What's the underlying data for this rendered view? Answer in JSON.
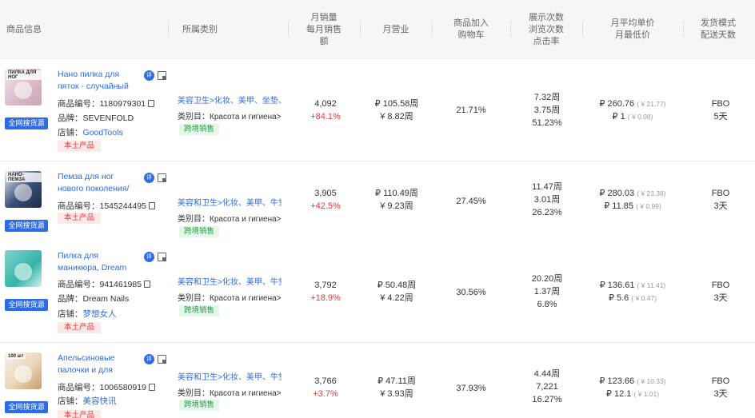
{
  "header": {
    "product_info": "商品信息",
    "category": "所属类别",
    "monthly_sales_1": "月销量",
    "monthly_sales_2": "每月销售",
    "monthly_sales_3": "额",
    "monthly_revenue": "月营业",
    "cart_1": "商品加入",
    "cart_2": "购物车",
    "views_1": "展示次数",
    "views_2": "浏览次数",
    "views_3": "点击率",
    "price_1": "月平均单价",
    "price_2": "月最低价",
    "ship_1": "发货模式",
    "ship_2": "配送天数"
  },
  "labels": {
    "search_badge": "全网搜货源",
    "eval_icon": "评",
    "sku_key": "商品编号：",
    "brand_key": "品牌：",
    "shop_key": "店铺：",
    "local_tag": "本土产品",
    "cat_key": "类别目：",
    "cross_tag": "跨境销售"
  },
  "rows": [
    {
      "thumb_text": "ПИЛКА ДЛЯ НОГ",
      "title": "Нано пилка для пяток - случайный цвет / Т...",
      "sku": "1180979301",
      "brand": "SEVENFOLD",
      "shop": "GoodTools",
      "category": "美容卫生>化妆、美甲、坐垫、",
      "sub_category": "Красота и гигиена>",
      "sales": "4,092",
      "sales_growth": "+84.1%",
      "revenue": "₽ 105.58周",
      "revenue_cny": "¥ 8.82周",
      "cart_rate": "21.71%",
      "views": "7.32周",
      "clicks": "3.75周",
      "ctr": "51.23%",
      "avg_price": "₽ 260.76",
      "avg_price_cny": "( ¥ 21.77)",
      "min_price": "₽ 1",
      "min_price_cny": "( ¥ 0.08)",
      "ship_mode": "FBO",
      "ship_days": "5天"
    },
    {
      "thumb_text": "НАНО-ПЕМЗА",
      "title": "Пемза для ног нового поколения/ Терка дл...",
      "sku": "1545244495",
      "brand": "",
      "shop": "",
      "category": "美容和卫生>化妆、美甲、牛堂、",
      "sub_category": "Красота и гигиена>",
      "sales": "3,905",
      "sales_growth": "+42.5%",
      "revenue": "₽ 110.49周",
      "revenue_cny": "¥ 9.23周",
      "cart_rate": "27.45%",
      "views": "11.47周",
      "clicks": "3.01周",
      "ctr": "26.23%",
      "avg_price": "₽ 280.03",
      "avg_price_cny": "( ¥ 23.38)",
      "min_price": "₽ 11.85",
      "min_price_cny": "( ¥ 0.99)",
      "ship_mode": "FBO",
      "ship_days": "3天"
    },
    {
      "thumb_text": "",
      "title": "Пилка для маникюра, Dream Nails набор пи...",
      "sku": "941461985",
      "brand": "Dream Nails",
      "shop": "梦想女人",
      "category": "美容和卫生>化妆、美甲、牛堂、",
      "sub_category": "Красота и гигиена>",
      "sales": "3,792",
      "sales_growth": "+18.9%",
      "revenue": "₽ 50.48周",
      "revenue_cny": "¥ 4.22周",
      "cart_rate": "30.56%",
      "views": "20.20周",
      "clicks": "1.37周",
      "ctr": "6.8%",
      "avg_price": "₽ 136.61",
      "avg_price_cny": "( ¥ 11.41)",
      "min_price": "₽ 5.6",
      "min_price_cny": "( ¥ 0.47)",
      "ship_mode": "FBO",
      "ship_days": "3天"
    },
    {
      "thumb_text": "100 шт",
      "title": "Апельсиновые палочки и для маникюра, пал...",
      "sku": "1006580919",
      "brand": "",
      "shop": "美容快讯",
      "category": "美容和卫生>化妆、美甲、牛堂、",
      "sub_category": "Красота и гигиена>",
      "sales": "3,766",
      "sales_growth": "+3.7%",
      "revenue": "₽ 47.11周",
      "revenue_cny": "¥ 3.93周",
      "cart_rate": "37.93%",
      "views": "4.44周",
      "clicks": "7,221",
      "ctr": "16.27%",
      "avg_price": "₽ 123.66",
      "avg_price_cny": "( ¥ 10.33)",
      "min_price": "₽ 12.1",
      "min_price_cny": "( ¥ 1.01)",
      "ship_mode": "FBO",
      "ship_days": "3天"
    }
  ]
}
